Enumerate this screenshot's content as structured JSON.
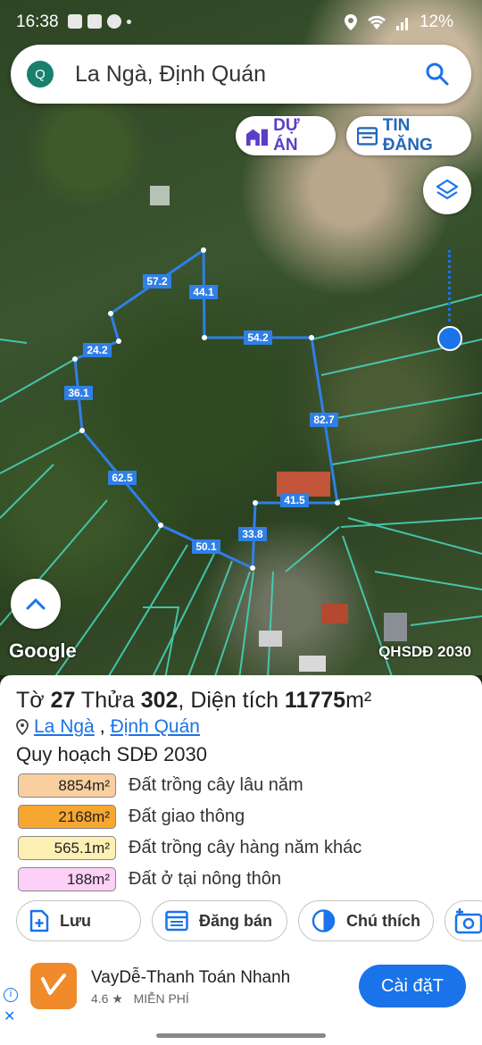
{
  "status_bar": {
    "time": "16:38",
    "battery": "12%"
  },
  "search": {
    "badge": "Q",
    "query": "La Ngà, Định Quán"
  },
  "map": {
    "projects_pill": "DỰ ÁN",
    "listings_pill": "TIN ĐĂNG",
    "edge_labels": [
      "57.2",
      "44.1",
      "54.2",
      "24.2",
      "36.1",
      "82.7",
      "62.5",
      "41.5",
      "33.8",
      "50.1"
    ],
    "attribution": "Google",
    "layer_label": "QHSDĐ 2030",
    "colors": {
      "parcel_outline": "#2f7fe6",
      "boundary_lines": "#47d1b8"
    }
  },
  "parcel": {
    "prefix1": "Tờ ",
    "sheet_no": "27",
    "prefix2": " Thửa ",
    "lot_no": "302",
    "prefix3": ", Diện tích ",
    "area": "11775",
    "unit": "m²",
    "address_commune": "La Ngà",
    "address_sep": ", ",
    "address_district": "Định Quán",
    "plan_title": "Quy hoạch SDĐ 2030",
    "land_uses": [
      {
        "area": "8854m²",
        "label": "Đất trồng cây lâu năm",
        "color": "#f9cf9f"
      },
      {
        "area": "2168m²",
        "label": "Đất giao thông",
        "color": "#f7a630"
      },
      {
        "area": "565.1m²",
        "label": "Đất trồng cây hàng năm khác",
        "color": "#fdf0b5"
      },
      {
        "area": "188m²",
        "label": "Đất ở tại nông thôn",
        "color": "#fcd0f7"
      }
    ]
  },
  "actions": {
    "save": "Lưu",
    "sell": "Đăng bán",
    "legend": "Chú thích"
  },
  "ad": {
    "title": "VayDễ-Thanh Toán Nhanh",
    "rating": "4.6 ★",
    "price": "MIỄN PHÍ",
    "cta": "Cài đặT",
    "info": "i",
    "close": "✕"
  }
}
